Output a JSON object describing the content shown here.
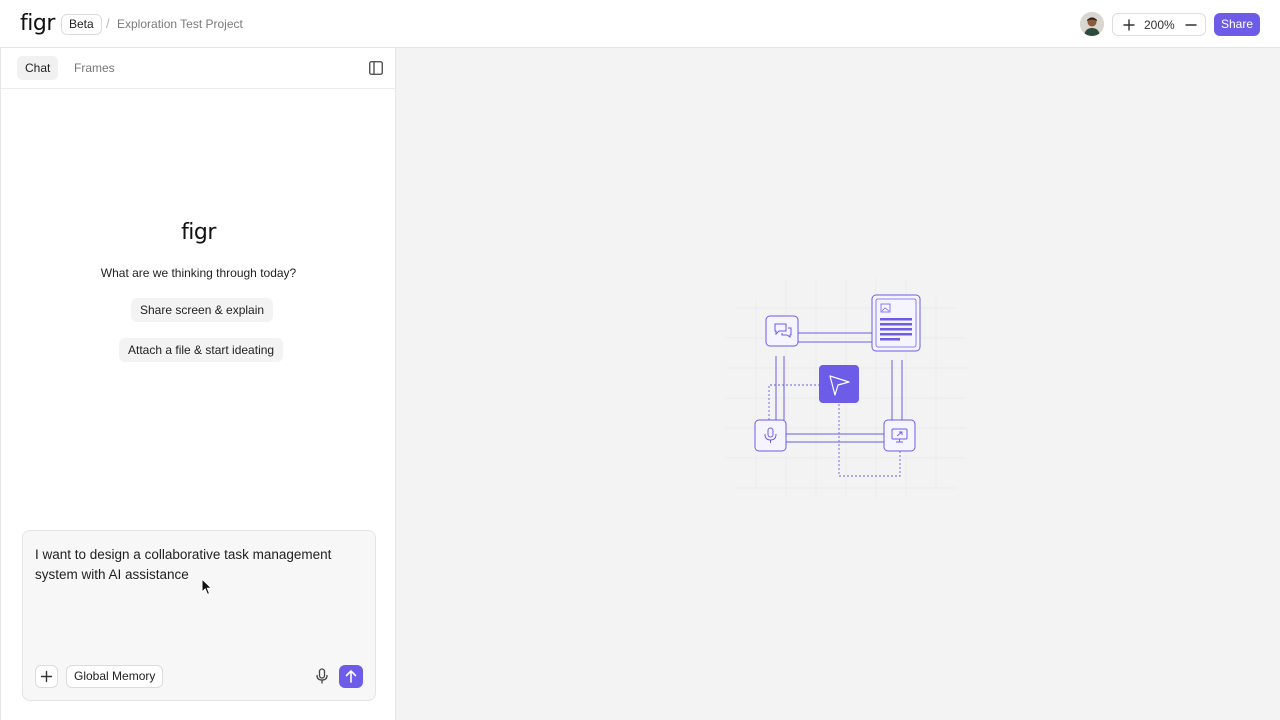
{
  "header": {
    "logo": "figr",
    "badge": "Beta",
    "separator": "/",
    "project_name": "Exploration Test Project",
    "zoom_level": "200%",
    "share_label": "Share"
  },
  "panel": {
    "tabs": [
      {
        "label": "Chat",
        "active": true
      },
      {
        "label": "Frames",
        "active": false
      }
    ],
    "logo": "figr",
    "question": "What are we thinking through today?",
    "suggestions": [
      "Share screen & explain",
      "Attach a file & start ideating"
    ]
  },
  "chat_input": {
    "value": "I want to design a collaborative task management system with AI assistance",
    "memory_label": "Global Memory"
  },
  "colors": {
    "accent": "#6c5ce7",
    "canvas_bg": "#f3f3f3"
  },
  "icons": {
    "zoom_in": "plus-icon",
    "zoom_out": "minus-icon",
    "sidebar_toggle": "sidebar-toggle-icon",
    "attach": "plus-icon",
    "mic": "microphone-icon",
    "send": "arrow-up-icon"
  }
}
